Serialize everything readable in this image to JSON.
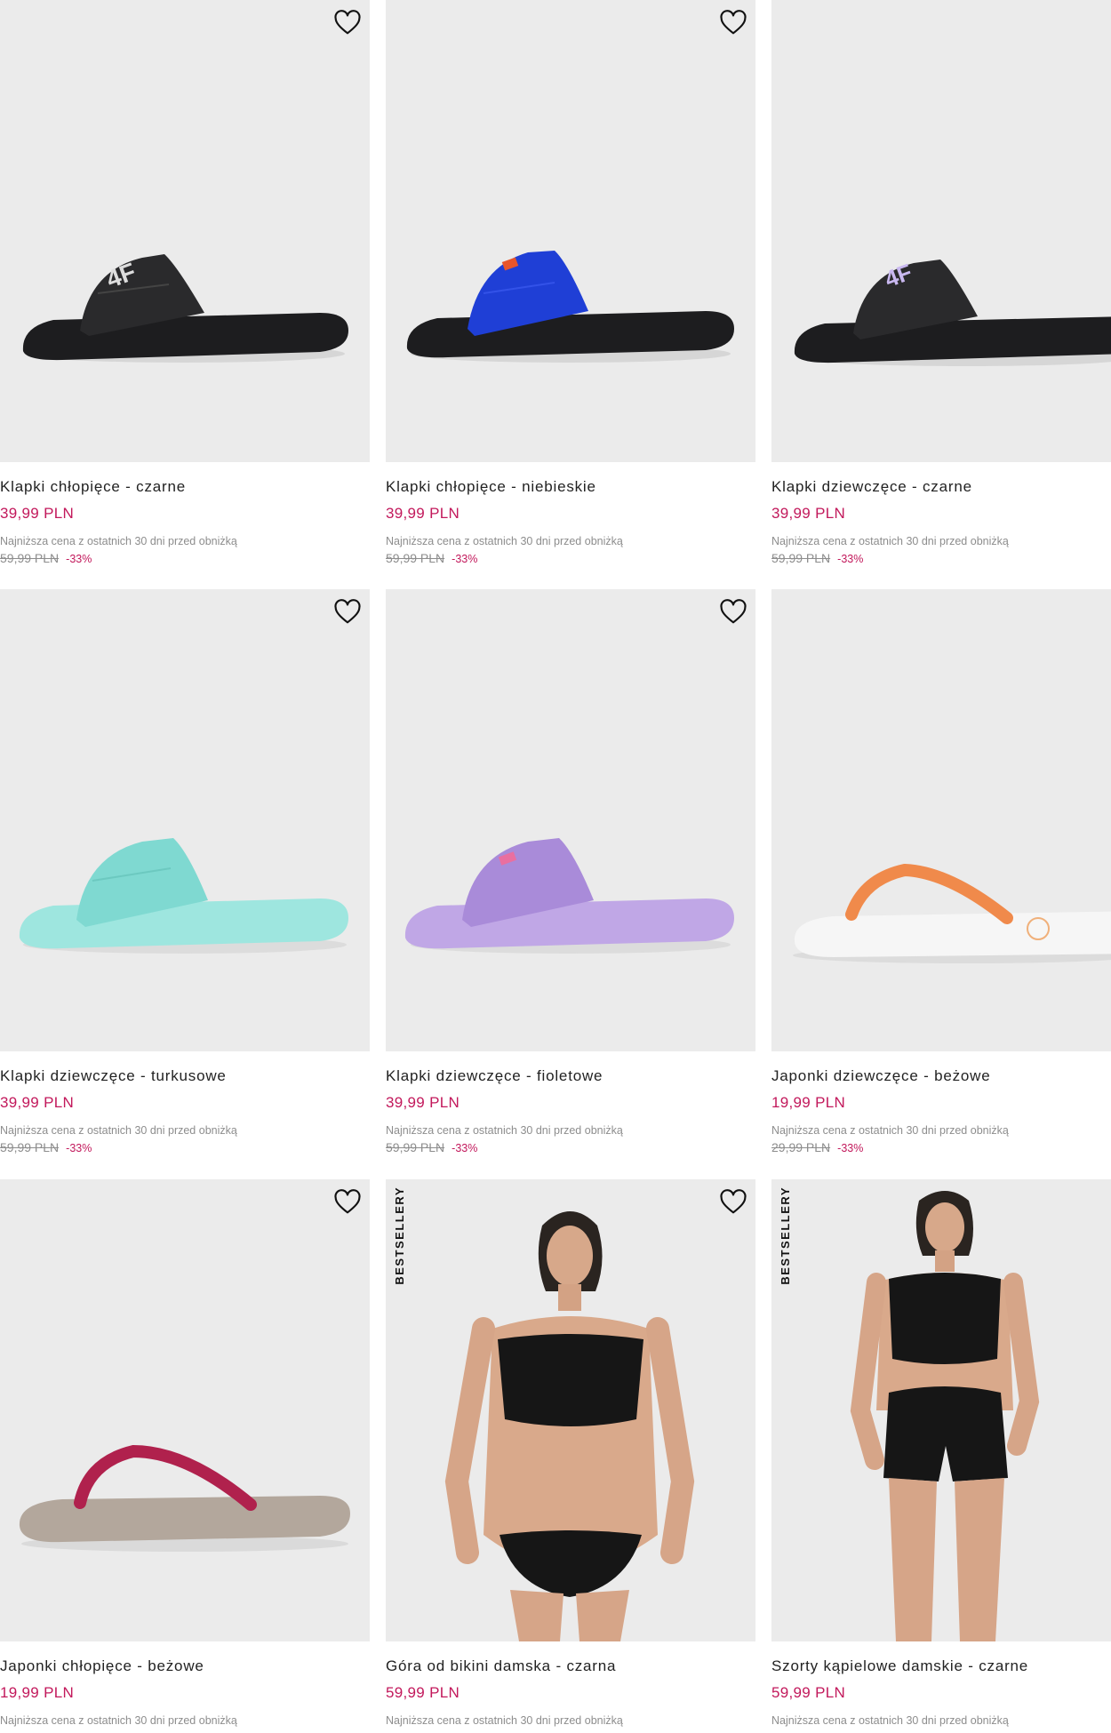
{
  "colors": {
    "accent": "#c2185b",
    "card_bg": "#ebebeb",
    "muted": "#8d8d8d"
  },
  "products": [
    {
      "name": "Klapki chłopięce - czarne",
      "price": "39,99 PLN",
      "lowest_note": "Najniższa cena z ostatnich 30 dni przed obniżką",
      "old_price": "59,99 PLN",
      "discount": "-33%",
      "badge": "",
      "icon": "heart-icon"
    },
    {
      "name": "Klapki chłopięce - niebieskie",
      "price": "39,99 PLN",
      "lowest_note": "Najniższa cena z ostatnich 30 dni przed obniżką",
      "old_price": "59,99 PLN",
      "discount": "-33%",
      "badge": "",
      "icon": "heart-icon"
    },
    {
      "name": "Klapki dziewczęce - czarne",
      "price": "39,99 PLN",
      "lowest_note": "Najniższa cena z ostatnich 30 dni przed obniżką",
      "old_price": "59,99 PLN",
      "discount": "-33%",
      "badge": "",
      "icon": "heart-icon"
    },
    {
      "name": "Klapki dziewczęce - turkusowe",
      "price": "39,99 PLN",
      "lowest_note": "Najniższa cena z ostatnich 30 dni przed obniżką",
      "old_price": "59,99 PLN",
      "discount": "-33%",
      "badge": "",
      "icon": "heart-icon"
    },
    {
      "name": "Klapki dziewczęce - fioletowe",
      "price": "39,99 PLN",
      "lowest_note": "Najniższa cena z ostatnich 30 dni przed obniżką",
      "old_price": "59,99 PLN",
      "discount": "-33%",
      "badge": "",
      "icon": "heart-icon"
    },
    {
      "name": "Japonki dziewczęce - beżowe",
      "price": "19,99 PLN",
      "lowest_note": "Najniższa cena z ostatnich 30 dni przed obniżką",
      "old_price": "29,99 PLN",
      "discount": "-33%",
      "badge": "",
      "icon": "heart-icon"
    },
    {
      "name": "Japonki chłopięce - beżowe",
      "price": "19,99 PLN",
      "lowest_note": "Najniższa cena z ostatnich 30 dni przed obniżką",
      "old_price": "",
      "discount": "",
      "badge": "",
      "icon": "heart-icon"
    },
    {
      "name": "Góra od bikini damska - czarna",
      "price": "59,99 PLN",
      "lowest_note": "Najniższa cena z ostatnich 30 dni przed obniżką",
      "old_price": "",
      "discount": "",
      "badge": "BESTSELLERY",
      "icon": "heart-icon"
    },
    {
      "name": "Szorty kąpielowe damskie - czarne",
      "price": "59,99 PLN",
      "lowest_note": "Najniższa cena z ostatnich 30 dni przed obniżką",
      "old_price": "",
      "discount": "",
      "badge": "BESTSELLERY",
      "icon": "heart-icon"
    }
  ]
}
